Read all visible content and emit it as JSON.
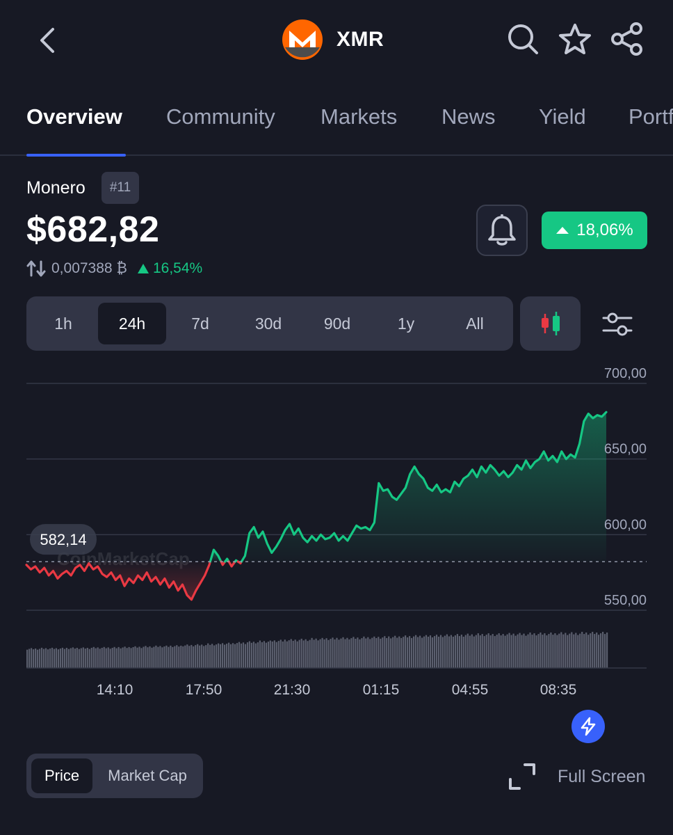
{
  "header": {
    "back_icon": "chevron-left-icon",
    "coin_icon": "monero-logo",
    "symbol": "XMR",
    "actions": [
      "search-icon",
      "star-icon",
      "share-icon"
    ]
  },
  "tabs": [
    {
      "label": "Overview",
      "active": true
    },
    {
      "label": "Community",
      "active": false
    },
    {
      "label": "Markets",
      "active": false
    },
    {
      "label": "News",
      "active": false
    },
    {
      "label": "Yield",
      "active": false
    },
    {
      "label": "Portf",
      "active": false
    }
  ],
  "coin": {
    "name": "Monero",
    "rank": "#11",
    "price": "$682,82",
    "btc_price": "0,007388 ₿",
    "btc_change": "16,54%",
    "change_24h": "18,06%"
  },
  "time_ranges": [
    {
      "label": "1h",
      "active": false
    },
    {
      "label": "24h",
      "active": true
    },
    {
      "label": "7d",
      "active": false
    },
    {
      "label": "30d",
      "active": false
    },
    {
      "label": "90d",
      "active": false
    },
    {
      "label": "1y",
      "active": false
    },
    {
      "label": "All",
      "active": false
    }
  ],
  "chart_type_icon": "candlestick-icon",
  "settings_icon": "sliders-icon",
  "chart_data": {
    "type": "line",
    "watermark": "CoinMarketCap",
    "open_price_label": "582,14",
    "open_price": 582.14,
    "ylim": [
      540,
      710
    ],
    "yticks": [
      {
        "value": 700,
        "label": "700,00"
      },
      {
        "value": 650,
        "label": "650,00"
      },
      {
        "value": 600,
        "label": "600,00"
      },
      {
        "value": 550,
        "label": "550,00"
      }
    ],
    "x_tick_labels": [
      "14:10",
      "17:50",
      "21:30",
      "01:15",
      "04:55",
      "08:35"
    ],
    "colors": {
      "up": "#16c784",
      "down": "#ea3943"
    },
    "series": [
      {
        "values": [
          580,
          577,
          579,
          575,
          578,
          573,
          576,
          571,
          574,
          576,
          573,
          578,
          580,
          576,
          581,
          577,
          579,
          574,
          572,
          575,
          570,
          573,
          566,
          571,
          568,
          573,
          570,
          575,
          569,
          572,
          567,
          571,
          565,
          569,
          563,
          567,
          560,
          557,
          563,
          568,
          573,
          580,
          590,
          586,
          580,
          584,
          579,
          583,
          581,
          586,
          601,
          605,
          598,
          602,
          594,
          588,
          592,
          597,
          603,
          607,
          600,
          604,
          598,
          595,
          599,
          596,
          600,
          597,
          598,
          601,
          596,
          599,
          596,
          601,
          606,
          604,
          605,
          603,
          608,
          634,
          629,
          630,
          625,
          623,
          627,
          631,
          640,
          645,
          640,
          637,
          631,
          629,
          633,
          628,
          630,
          628,
          635,
          632,
          637,
          639,
          643,
          638,
          645,
          641,
          646,
          643,
          639,
          642,
          638,
          641,
          646,
          643,
          649,
          644,
          648,
          650,
          655,
          649,
          652,
          648,
          655,
          650,
          653,
          651,
          660,
          675,
          680,
          677,
          679,
          678,
          681
        ]
      }
    ],
    "volume": [
      0.55,
      0.56,
      0.56,
      0.57,
      0.57,
      0.58,
      0.58,
      0.59,
      0.6,
      0.61,
      0.62,
      0.63,
      0.65,
      0.66,
      0.68,
      0.7,
      0.72,
      0.74,
      0.76,
      0.78,
      0.8,
      0.81,
      0.83,
      0.84,
      0.85,
      0.86,
      0.87,
      0.88,
      0.89,
      0.9,
      0.91,
      0.92,
      0.93,
      0.94,
      0.95,
      0.96,
      0.96,
      0.97,
      0.97,
      0.98,
      0.98,
      0.99,
      0.99,
      1.0,
      1.0,
      1.0
    ]
  },
  "bolt_icon": "lightning-icon",
  "metric_toggle": [
    {
      "label": "Price",
      "active": true
    },
    {
      "label": "Market Cap",
      "active": false
    }
  ],
  "fullscreen": {
    "label": "Full Screen",
    "icon": "expand-icon"
  }
}
